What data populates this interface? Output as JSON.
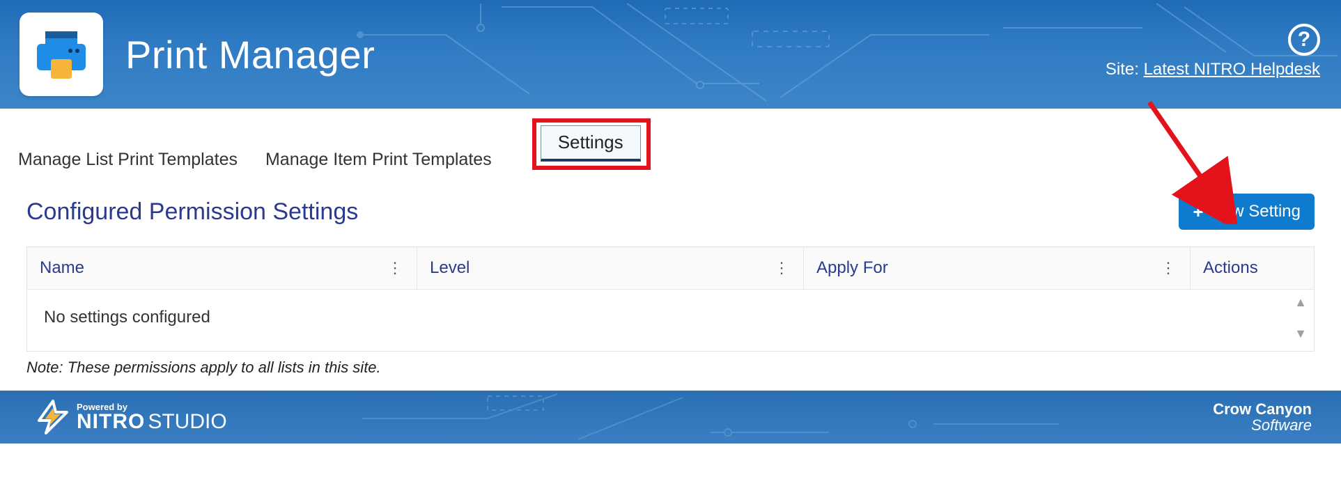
{
  "header": {
    "app_title": "Print Manager",
    "site_label_prefix": "Site: ",
    "site_name": "Latest NITRO Helpdesk",
    "help_glyph": "?"
  },
  "tabs": {
    "list_templates": "Manage List Print Templates",
    "item_templates": "Manage Item Print Templates",
    "settings": "Settings"
  },
  "section": {
    "title": "Configured Permission Settings",
    "new_button": "New Setting"
  },
  "table": {
    "columns": {
      "name": "Name",
      "level": "Level",
      "apply_for": "Apply For",
      "actions": "Actions"
    },
    "empty_message": "No settings configured"
  },
  "note": "Note: These permissions apply to all lists in this site.",
  "footer": {
    "powered_by": "Powered by",
    "nitro": "NITRO",
    "studio": "STUDIO",
    "cc_top": "Crow Canyon",
    "cc_bottom": "Software"
  }
}
